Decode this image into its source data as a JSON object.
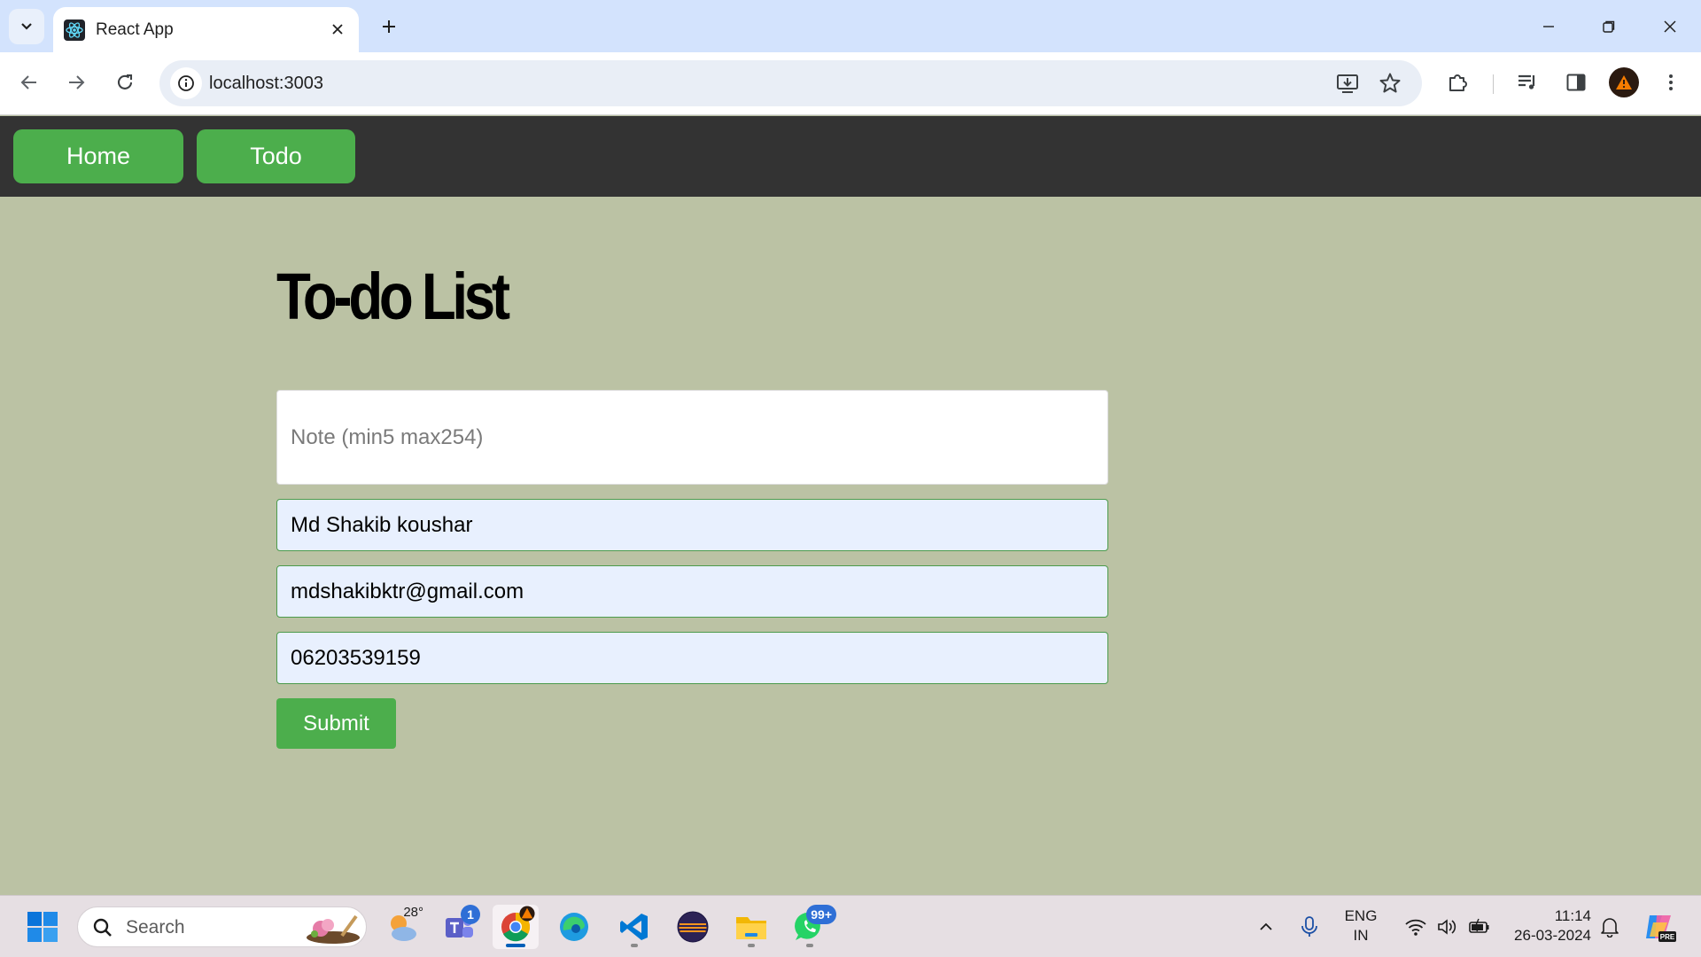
{
  "browser": {
    "tab_title": "React App",
    "url": "localhost:3003"
  },
  "nav": {
    "home_label": "Home",
    "todo_label": "Todo"
  },
  "page": {
    "title": "To-do List"
  },
  "form": {
    "note_placeholder": "Note (min5 max254)",
    "name_value": "Md Shakib koushar",
    "email_value": "mdshakibktr@gmail.com",
    "phone_value": "06203539159",
    "submit_label": "Submit"
  },
  "taskbar": {
    "search_placeholder": "Search",
    "weather_temp": "28°",
    "teams_badge": "1",
    "whatsapp_badge": "99+",
    "lang_line1": "ENG",
    "lang_line2": "IN",
    "time": "11:14",
    "date": "26-03-2024"
  },
  "colors": {
    "accent_green": "#4cae4c",
    "nav_bg": "#333333",
    "page_bg": "#bbc2a4"
  }
}
